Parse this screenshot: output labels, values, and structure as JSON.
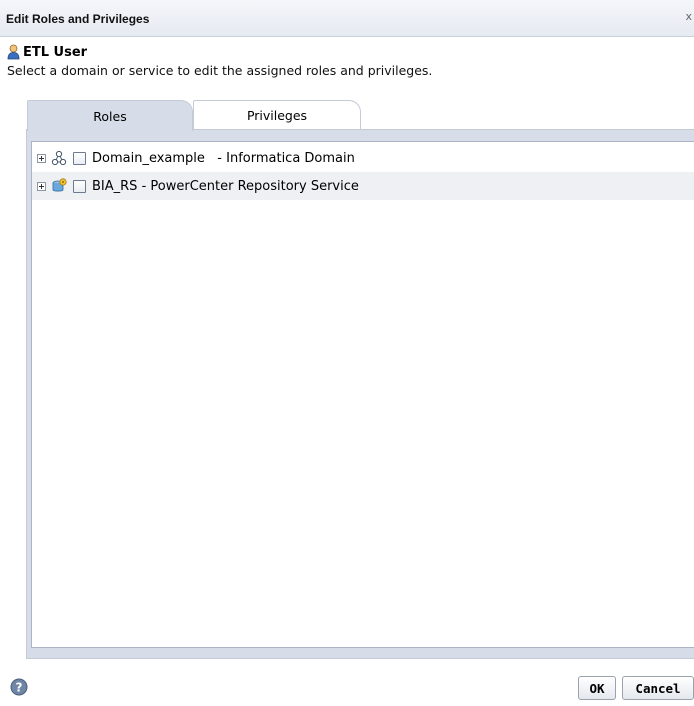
{
  "dialog": {
    "title": "Edit Roles and Privileges",
    "close_glyph": "x"
  },
  "user": {
    "name": "ETL User",
    "icon": "user-icon"
  },
  "instruction": "Select a domain or service to edit the assigned roles and privileges.",
  "tabs": [
    {
      "label": "Roles",
      "active": true
    },
    {
      "label": "Privileges",
      "active": false
    }
  ],
  "tree": [
    {
      "label": "Domain_example   - Informatica Domain",
      "icon": "domain-icon",
      "checked": false
    },
    {
      "label": "BIA_RS - PowerCenter Repository Service",
      "icon": "repository-service-icon",
      "checked": false
    }
  ],
  "buttons": {
    "ok": "OK",
    "cancel": "Cancel"
  },
  "colors": {
    "tab_active": "#d6dde8",
    "row_alt": "#eef0f3",
    "titlebar": "#e6eaf1"
  }
}
